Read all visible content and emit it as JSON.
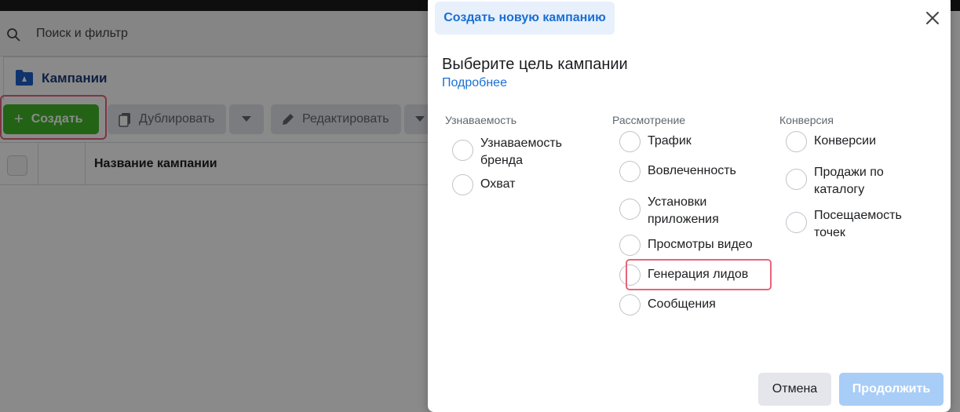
{
  "background": {
    "search": {
      "placeholder": "Поиск и фильтр",
      "icon": "search-icon"
    },
    "campaigns_title": "Кампании",
    "toolbar": {
      "create_label": "Создать",
      "duplicate_label": "Дублировать",
      "edit_label": "Редактировать"
    },
    "table": {
      "column_name": "Название кампании"
    }
  },
  "modal": {
    "tab_label": "Создать новую кампанию",
    "title": "Выберите цель кампании",
    "learn_more": "Подробнее",
    "columns": [
      {
        "heading": "Узнаваемость",
        "options": [
          "Узнаваемость бренда",
          "Охват"
        ]
      },
      {
        "heading": "Рассмотрение",
        "options": [
          "Трафик",
          "Вовлеченность",
          "Установки приложения",
          "Просмотры видео",
          "Генерация лидов",
          "Сообщения"
        ]
      },
      {
        "heading": "Конверсия",
        "options": [
          "Конверсии",
          "Продажи по каталогу",
          "Посещаемость точек"
        ]
      }
    ],
    "cancel_label": "Отмена",
    "continue_label": "Продолжить"
  },
  "colors": {
    "accent": "#1a6fd4",
    "create_green": "#42b72a",
    "highlight": "#e8657a",
    "continue_disabled": "#a8cdf7"
  }
}
